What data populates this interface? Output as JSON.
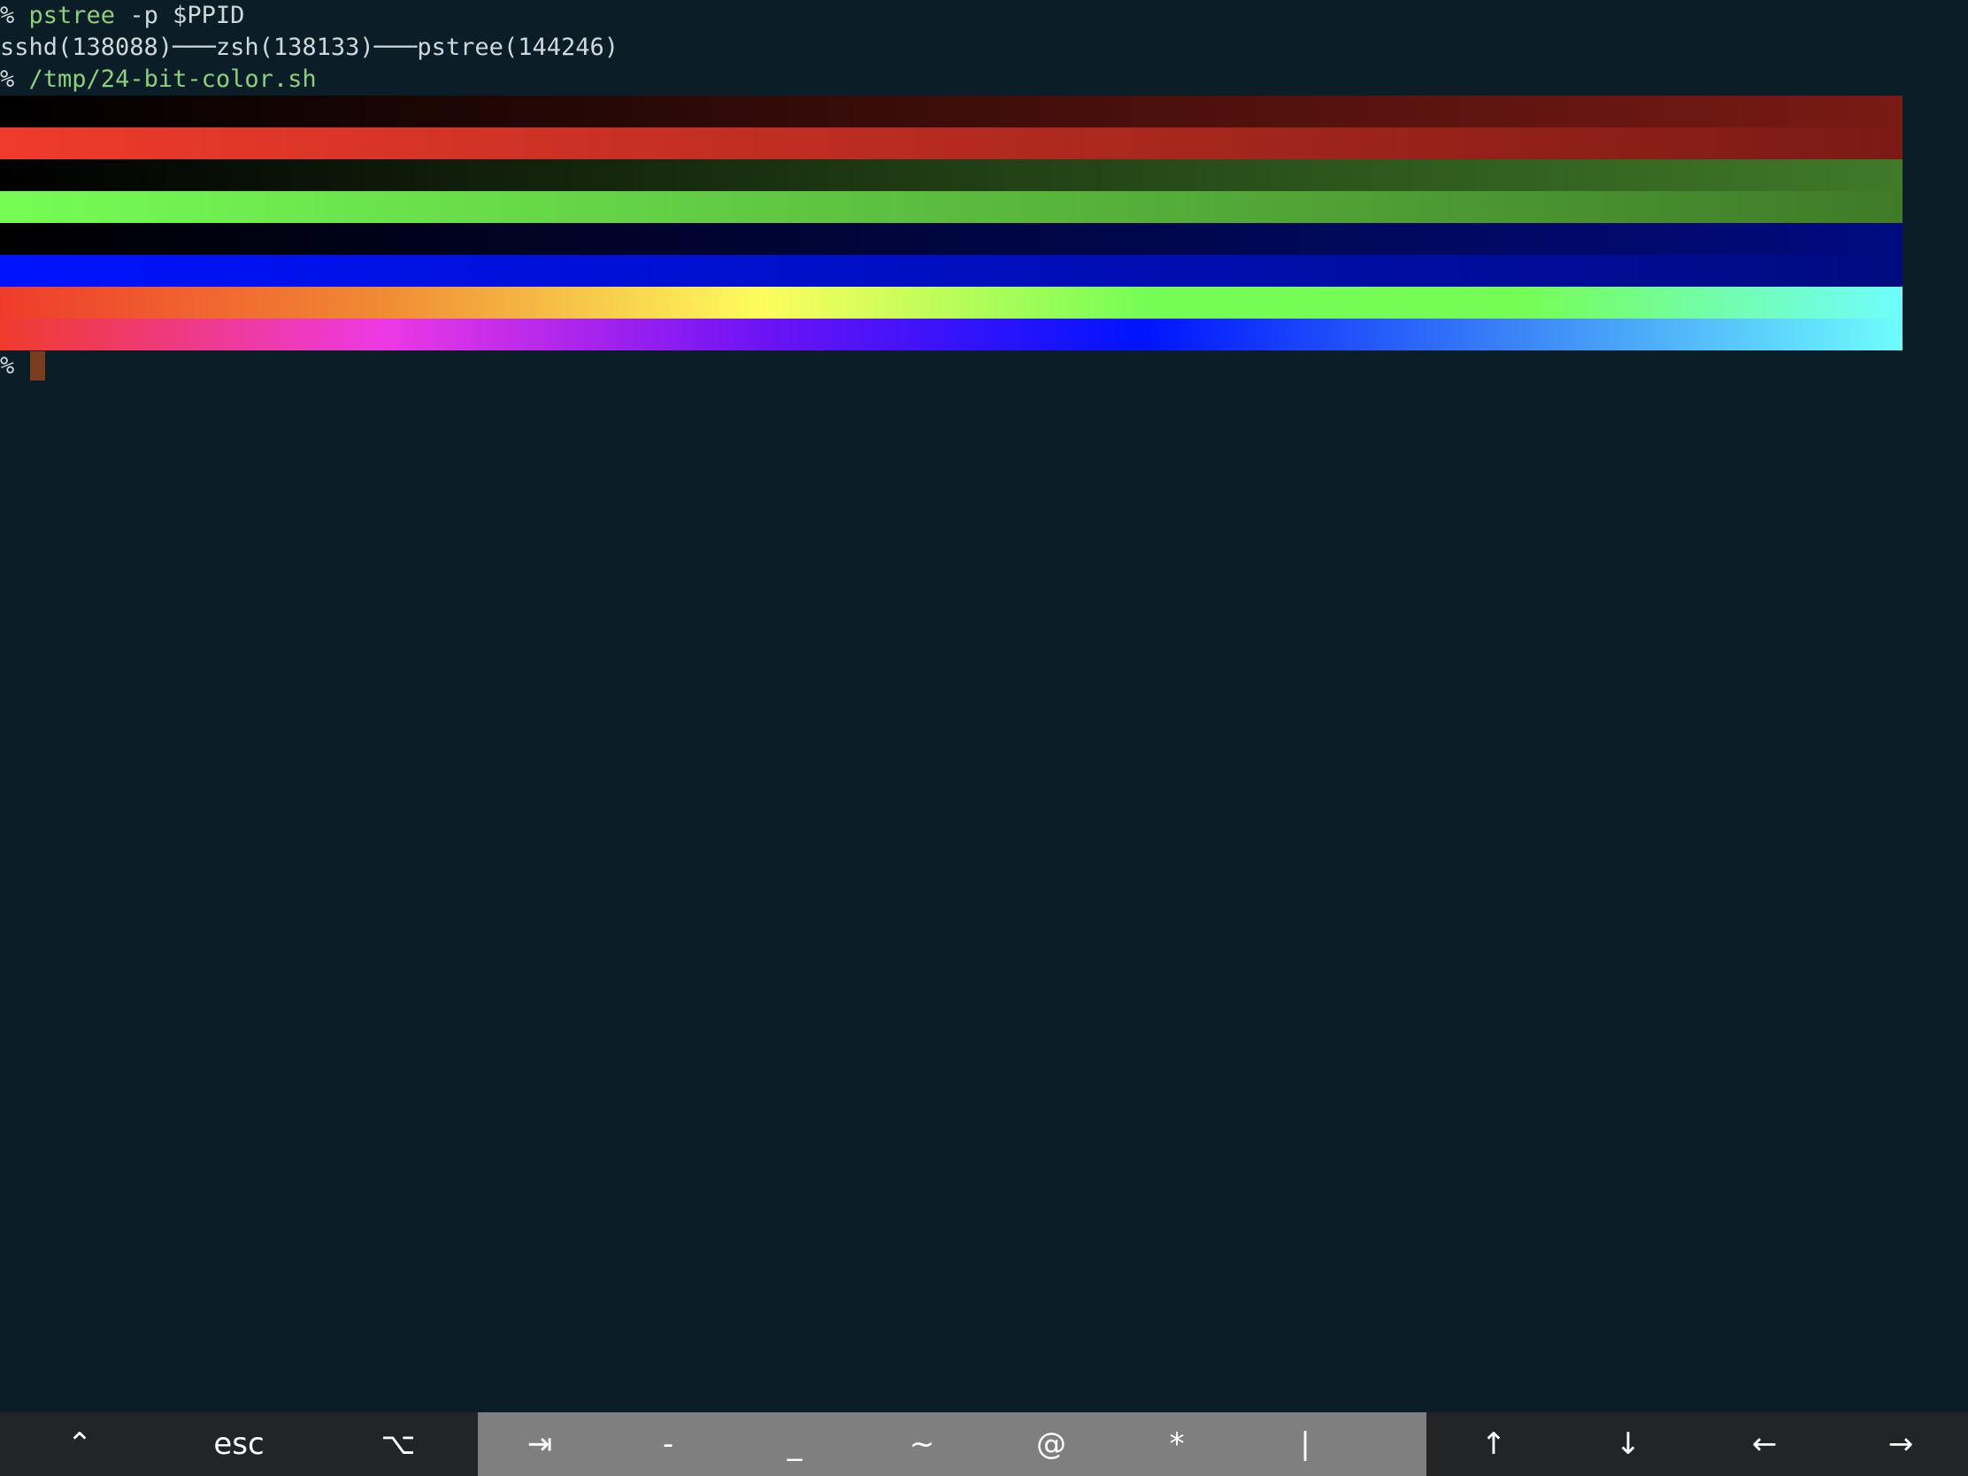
{
  "terminal": {
    "line1": {
      "prompt": "%",
      "cmd": "pstree",
      "args": " -p $PPID"
    },
    "line2": {
      "text": "sshd(138088)───zsh(138133)───pstree(144246)"
    },
    "line3": {
      "prompt": "%",
      "cmd": "/tmp/24-bit-color.sh"
    },
    "line4": {
      "prompt": "%"
    },
    "colors": {
      "background": "#0b1d26",
      "text": "#cfd8dc",
      "command": "#8bd17c",
      "cursor": "#7a3e1e"
    }
  },
  "color_bars": [
    {
      "name": "red-dark-gradient",
      "from": "#000000",
      "to": "#7a1a14"
    },
    {
      "name": "red-bright-gradient",
      "from": "#ef3b2c",
      "to": "#7a1a14"
    },
    {
      "name": "green-dark-gradient",
      "from": "#000000",
      "to": "#3f7a28"
    },
    {
      "name": "green-bright-gradient",
      "from": "#76fd55",
      "to": "#3f7a28"
    },
    {
      "name": "blue-dark-gradient",
      "from": "#000000",
      "to": "#000b7f"
    },
    {
      "name": "blue-bright-gradient",
      "from": "#0013ff",
      "to": "#000b7f"
    },
    {
      "name": "rainbow-upper",
      "stops": [
        "#ef3b2c",
        "#f08a33",
        "#fdfd5d",
        "#76fd55",
        "#76fd55",
        "#6ffdfd"
      ]
    },
    {
      "name": "rainbow-lower",
      "stops": [
        "#ef3b2c",
        "#ee39e3",
        "#6d13f5",
        "#0013ff",
        "#3c86f7",
        "#6ffdfd"
      ]
    }
  ],
  "keybar": {
    "ctrl": "⌃",
    "esc": "esc",
    "option": "⌥",
    "tab": "⇥",
    "dash": "-",
    "underscore": "_",
    "tilde": "~",
    "at": "@",
    "star": "*",
    "pipe": "|",
    "up": "↑",
    "down": "↓",
    "left": "←",
    "right": "→"
  }
}
